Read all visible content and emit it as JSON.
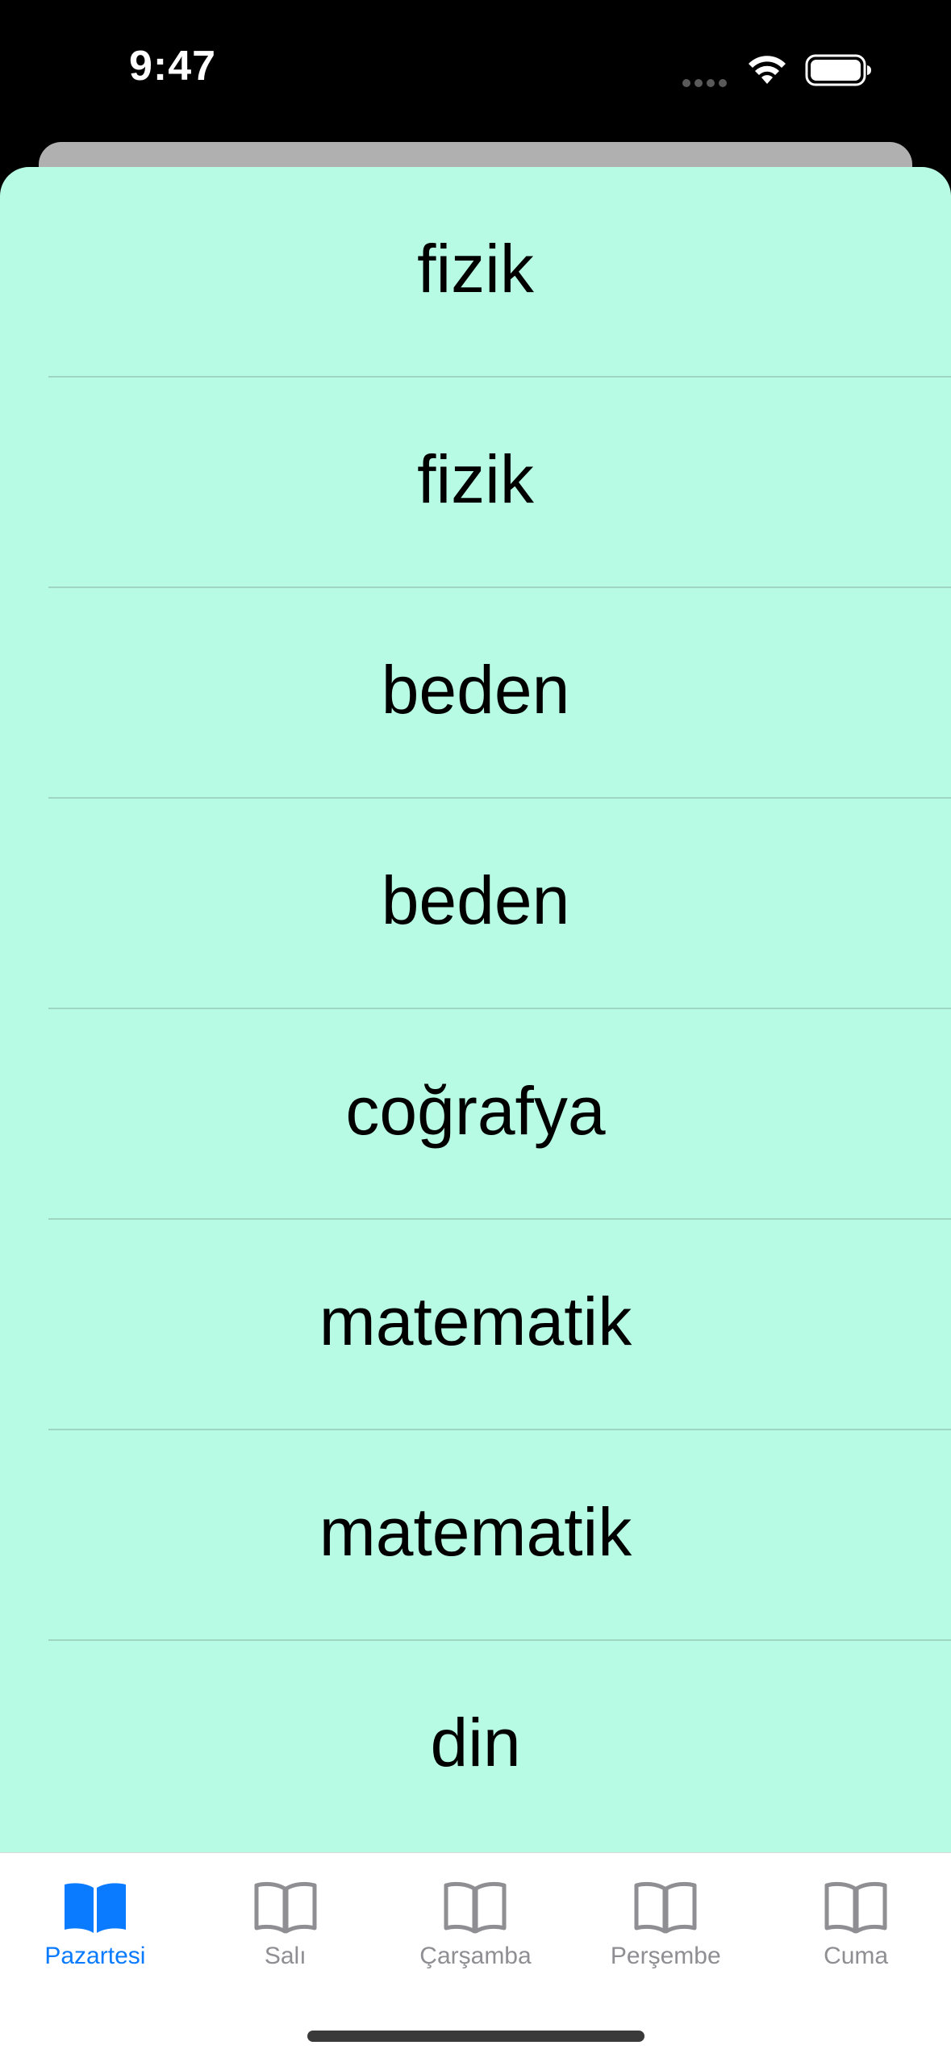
{
  "status_bar": {
    "time": "9:47",
    "icons": [
      "signal-dots-icon",
      "wifi-icon",
      "battery-icon"
    ]
  },
  "list": {
    "items": [
      {
        "label": "fizik"
      },
      {
        "label": "fizik"
      },
      {
        "label": "beden"
      },
      {
        "label": "beden"
      },
      {
        "label": "coğrafya"
      },
      {
        "label": "matematik"
      },
      {
        "label": "matematik"
      },
      {
        "label": "din"
      }
    ],
    "background_color": "#b8fbe4"
  },
  "tab_bar": {
    "tabs": [
      {
        "label": "Pazartesi",
        "icon": "book-icon",
        "selected": true
      },
      {
        "label": "Salı",
        "icon": "book-icon",
        "selected": false
      },
      {
        "label": "Çarşamba",
        "icon": "book-icon",
        "selected": false
      },
      {
        "label": "Perşembe",
        "icon": "book-icon",
        "selected": false
      },
      {
        "label": "Cuma",
        "icon": "book-icon",
        "selected": false
      }
    ],
    "active_color": "#0a7bff",
    "inactive_color": "#8e8e93"
  }
}
